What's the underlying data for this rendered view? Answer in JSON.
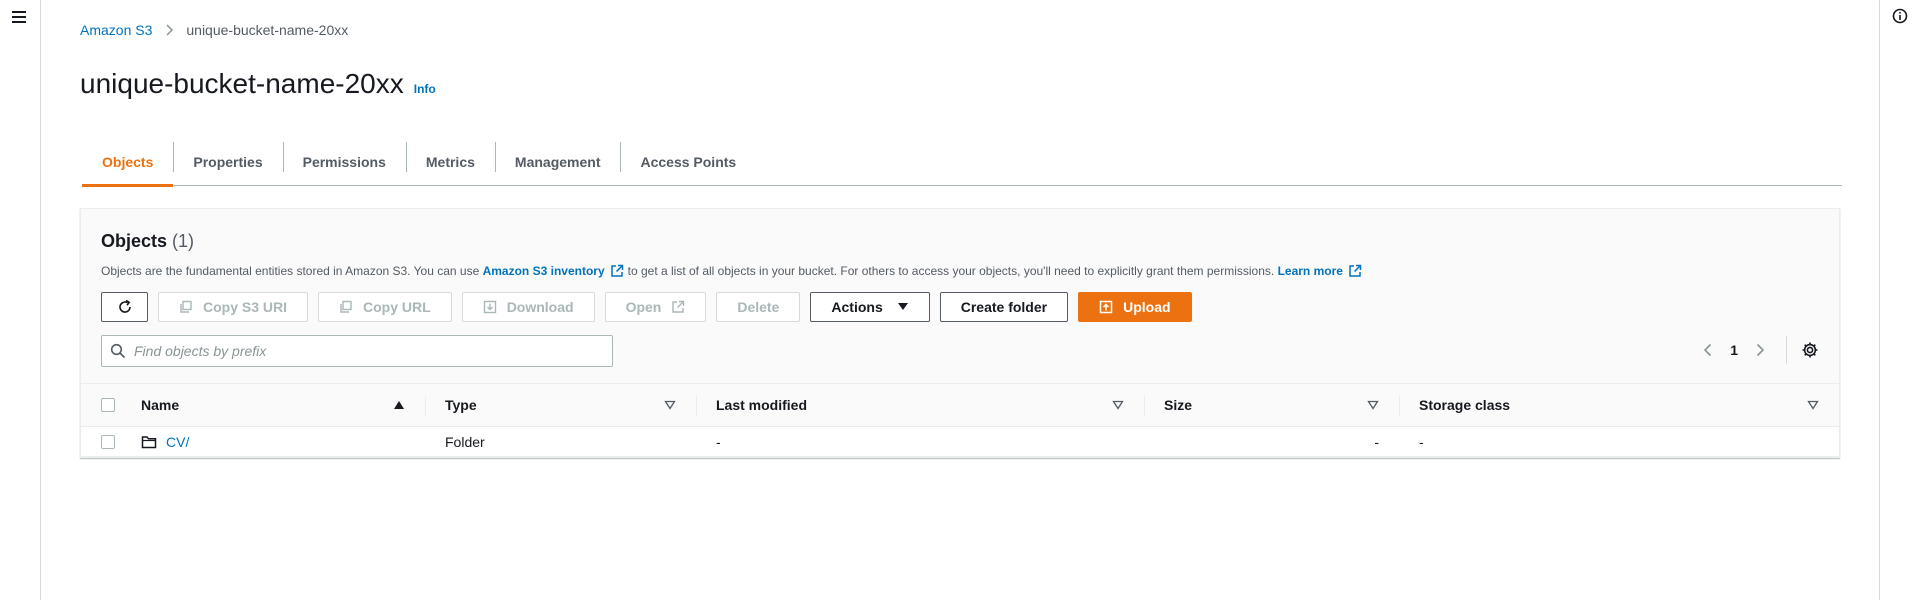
{
  "breadcrumb": {
    "root": "Amazon S3",
    "current": "unique-bucket-name-20xx"
  },
  "page": {
    "title": "unique-bucket-name-20xx",
    "info_label": "Info"
  },
  "tabs": [
    {
      "label": "Objects",
      "active": true
    },
    {
      "label": "Properties"
    },
    {
      "label": "Permissions"
    },
    {
      "label": "Metrics"
    },
    {
      "label": "Management"
    },
    {
      "label": "Access Points"
    }
  ],
  "objects_panel": {
    "title": "Objects",
    "count": "(1)",
    "desc_prefix": "Objects are the fundamental entities stored in Amazon S3. You can use",
    "desc_link": "Amazon S3 inventory",
    "desc_middle": "to get a list of all objects in your bucket. For others to access your objects, you'll need to explicitly grant them permissions.",
    "learn_more": "Learn more"
  },
  "toolbar": {
    "copy_s3_uri": "Copy S3 URI",
    "copy_url": "Copy URL",
    "download": "Download",
    "open": "Open",
    "delete": "Delete",
    "actions": "Actions",
    "create_folder": "Create folder",
    "upload": "Upload"
  },
  "search": {
    "placeholder": "Find objects by prefix",
    "value": ""
  },
  "pagination": {
    "current_page": "1"
  },
  "table": {
    "columns": {
      "name": "Name",
      "type": "Type",
      "last_modified": "Last modified",
      "size": "Size",
      "storage_class": "Storage class"
    },
    "rows": [
      {
        "name": "CV/",
        "type": "Folder",
        "last_modified": "-",
        "size": "-",
        "storage_class": "-"
      }
    ]
  },
  "colors": {
    "accent": "#ec7211",
    "link": "#0073bb",
    "text": "#16191f",
    "muted": "#545b64"
  }
}
